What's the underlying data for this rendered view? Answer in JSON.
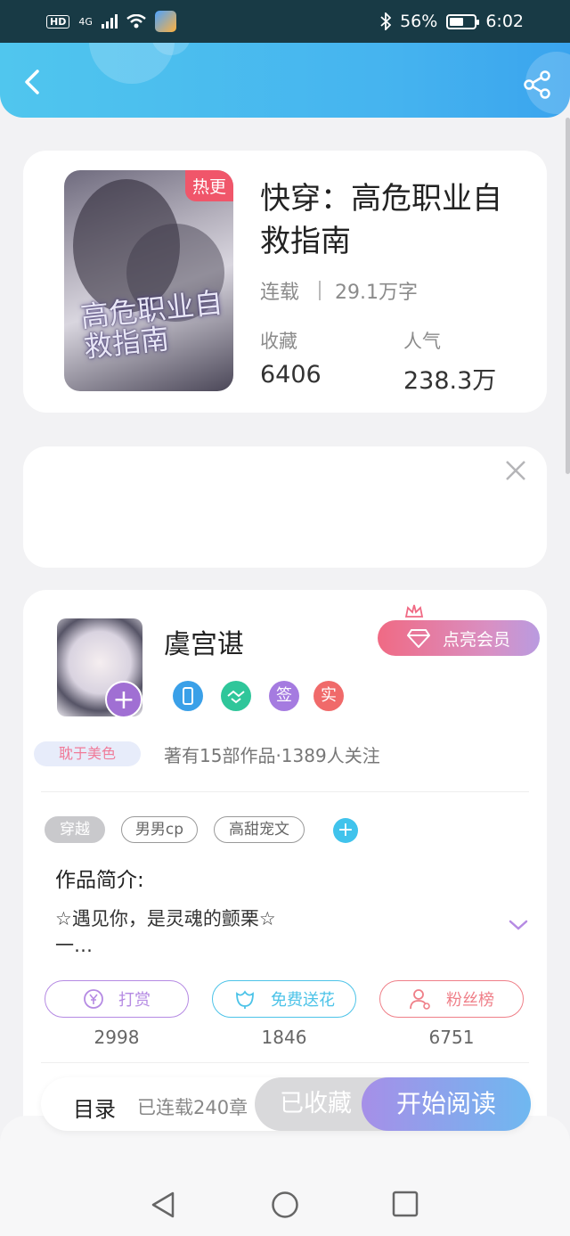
{
  "status_bar": {
    "left_badge": "HD",
    "network": "4G",
    "battery_percent": "56%",
    "battery_level": 0.56,
    "time": "6:02"
  },
  "header": {
    "back_icon": "chevron-left-icon",
    "share_icon": "share-icon"
  },
  "book": {
    "title": "快穿：高危职业自救指南",
    "badge": "热更",
    "status": "连载",
    "word_count": "29.1万字",
    "collect_label": "收藏",
    "collect_value": "6406",
    "popularity_label": "人气",
    "popularity_value": "238.3万",
    "cover_text": "高危职业自救指南"
  },
  "ad": {
    "close_icon": "close-icon"
  },
  "author": {
    "name": "虞宫谌",
    "tag": "耽于美色",
    "meta": "著有15部作品·1389人关注",
    "vip_label": "点亮会员",
    "badges": [
      {
        "text": "",
        "color": "#3aa0e8"
      },
      {
        "text": "",
        "color": "#2fc69a"
      },
      {
        "text": "签",
        "color": "#a57be0"
      },
      {
        "text": "实",
        "color": "#f06a6a"
      }
    ]
  },
  "tags": [
    {
      "label": "穿越",
      "selected": true
    },
    {
      "label": "男男cp",
      "selected": false
    },
    {
      "label": "高甜宠文",
      "selected": false
    }
  ],
  "intro": {
    "label": "作品简介:",
    "line1": "☆遇见你，是灵魂的颤栗☆",
    "line2": "一…"
  },
  "actions": [
    {
      "label": "打赏",
      "count": "2998",
      "color": "#b58ae3"
    },
    {
      "label": "免费送花",
      "count": "1846",
      "color": "#4cc3e8"
    },
    {
      "label": "粉丝榜",
      "count": "6751",
      "color": "#ef7f88"
    }
  ],
  "bottom_bar": {
    "toc_label": "目录",
    "chapters": "已连载240章",
    "fav_label": "已收藏",
    "read_label": "开始阅读"
  },
  "nav": {
    "back": "back-triangle-icon",
    "home": "home-circle-icon",
    "recent": "recents-square-icon"
  }
}
